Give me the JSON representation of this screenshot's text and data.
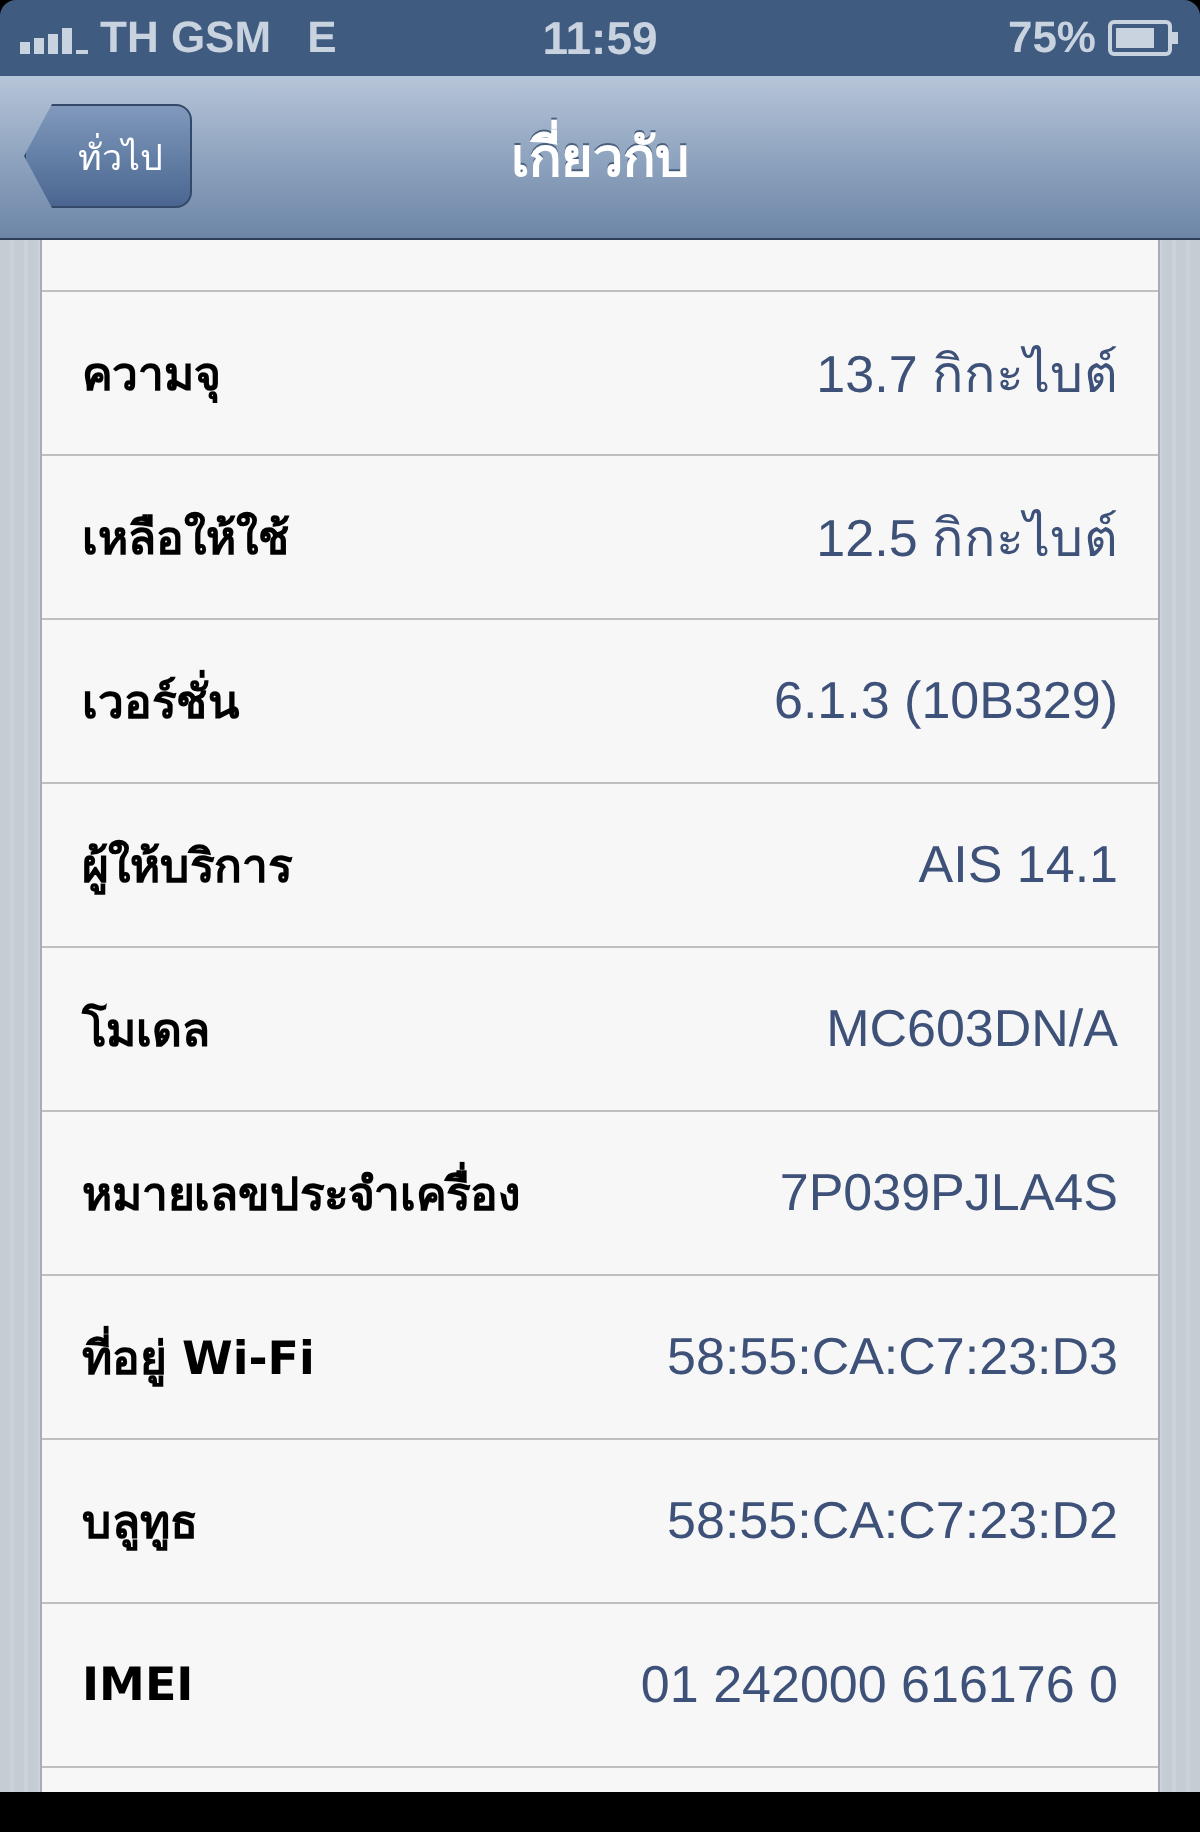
{
  "status_bar": {
    "carrier": "TH GSM",
    "network": "E",
    "time": "11:59",
    "battery": "75%"
  },
  "nav_bar": {
    "back": "ทั่วไป",
    "title": "เกี่ยวกับ"
  },
  "rows": [
    {
      "label": "ความจุ",
      "value": "13.7 กิกะไบต์"
    },
    {
      "label": "เหลือให้ใช้",
      "value": "12.5 กิกะไบต์"
    },
    {
      "label": "เวอร์ชั่น",
      "value": "6.1.3 (10B329)"
    },
    {
      "label": "ผู้ให้บริการ",
      "value": "AIS 14.1"
    },
    {
      "label": "โมเดล",
      "value": "MC603DN/A"
    },
    {
      "label": "หมายเลขประจำเครื่อง",
      "value": "7P039PJLA4S"
    },
    {
      "label": "ที่อยู่ Wi-Fi",
      "value": "58:55:CA:C7:23:D3"
    },
    {
      "label": "บลูทูธ",
      "value": "58:55:CA:C7:23:D2"
    },
    {
      "label": "IMEI",
      "value": "01 242000 616176 0"
    }
  ]
}
